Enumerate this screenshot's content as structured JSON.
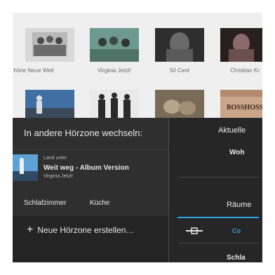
{
  "album_grid": {
    "row1_captions": [
      "höne Neue Welt",
      "Virginia Jetzt!",
      "50 Cent",
      "Christian Kr"
    ],
    "row2_badge": "BOSSHOSS"
  },
  "switch_panel": {
    "title": "In andere Hörzone wechseln:",
    "now_playing": {
      "album": "Land unter",
      "track": "Weit weg - Album Version",
      "artist": "Virginia Jetzt!"
    },
    "zones": [
      "Schlafzimmer",
      "Küche"
    ],
    "create_zone_label": "Neue Hörzone erstellen…"
  },
  "right_panel": {
    "header": "Aktuelle",
    "current_zone": "Woh",
    "rooms_tab": "Räume",
    "connect_label": "Co",
    "room_item": "Schla"
  },
  "colors": {
    "accent": "#2fa3e0",
    "panel_bg": "#2f2f2f",
    "panel_right_bg": "#262626"
  }
}
